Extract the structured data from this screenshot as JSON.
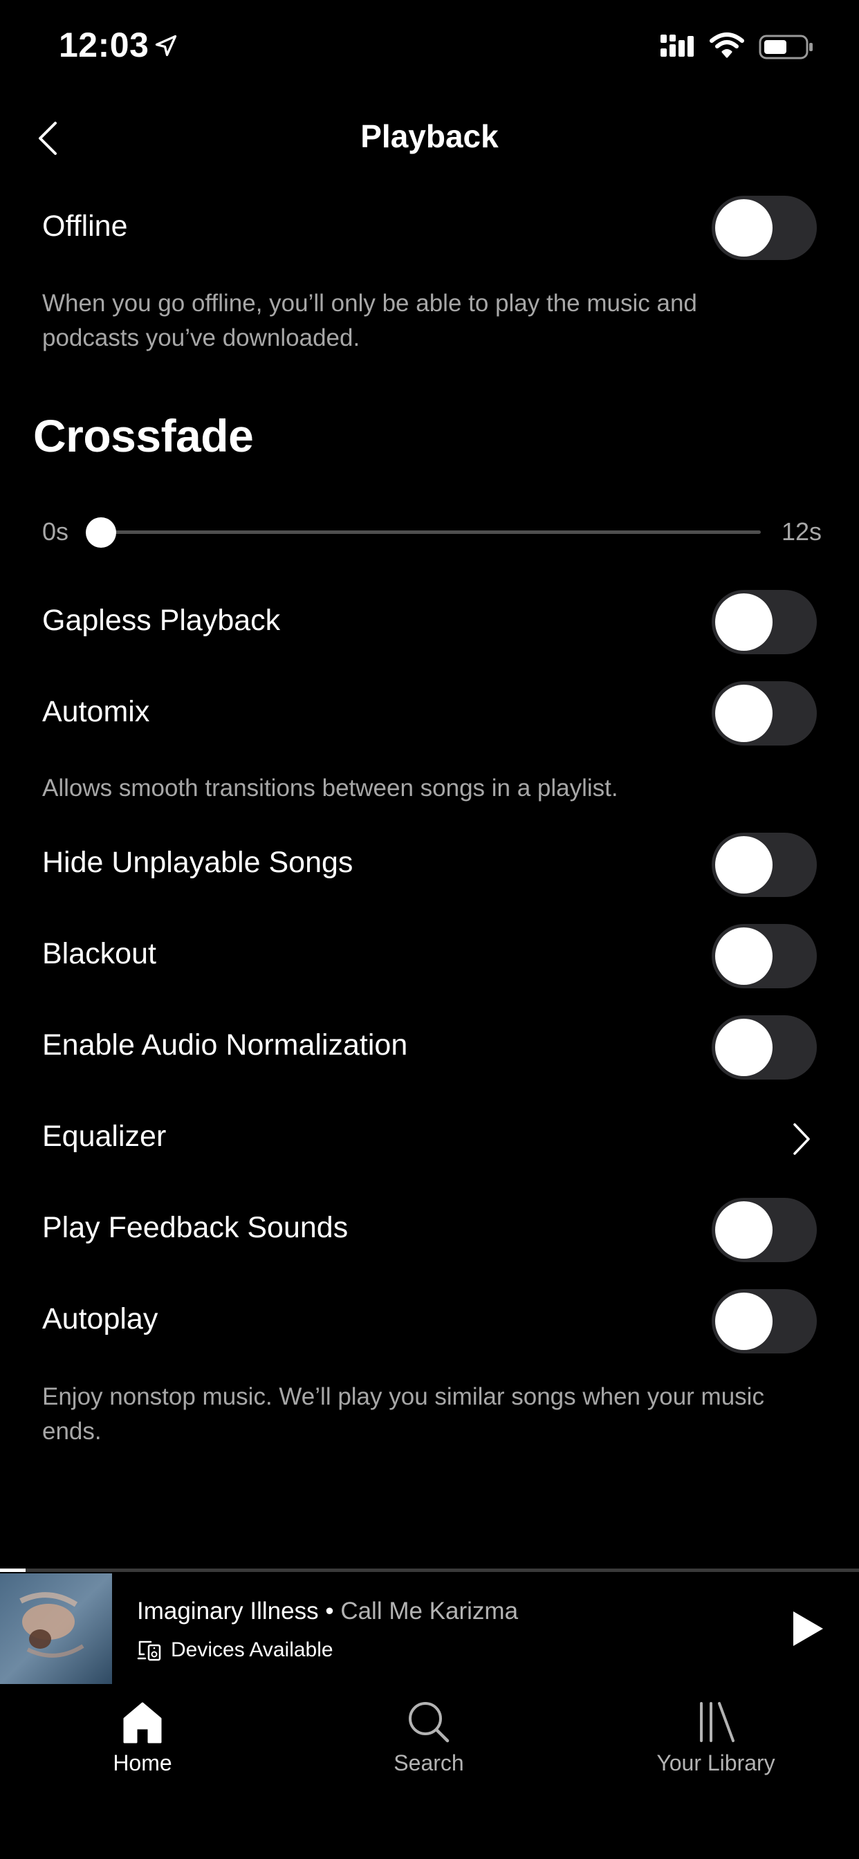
{
  "status_bar": {
    "time": "12:03"
  },
  "header": {
    "title": "Playback"
  },
  "offline": {
    "label": "Offline",
    "enabled": false,
    "description": "When you go offline, you’ll only be able to play the music and podcasts you’ve downloaded."
  },
  "crossfade": {
    "title": "Crossfade",
    "min_label": "0s",
    "max_label": "12s",
    "value_seconds": 0
  },
  "settings": {
    "gapless": {
      "label": "Gapless Playback",
      "enabled": false
    },
    "automix": {
      "label": "Automix",
      "enabled": false,
      "description": "Allows smooth transitions between songs in a playlist."
    },
    "hide_unplayable": {
      "label": "Hide Unplayable Songs",
      "enabled": false
    },
    "blackout": {
      "label": "Blackout",
      "enabled": false
    },
    "normalization": {
      "label": "Enable Audio Normalization",
      "enabled": false
    },
    "equalizer": {
      "label": "Equalizer"
    },
    "feedback_sounds": {
      "label": "Play Feedback Sounds",
      "enabled": false
    },
    "autoplay": {
      "label": "Autoplay",
      "enabled": false,
      "description": "Enjoy nonstop music. We’ll play you similar songs when your music ends."
    }
  },
  "now_playing": {
    "track": "Imaginary Illness",
    "separator": " • ",
    "artist": "Call Me Karizma",
    "device_label": "Devices Available",
    "progress": 0.03
  },
  "tab_bar": {
    "tabs": [
      {
        "label": "Home",
        "icon": "home-icon",
        "active": true
      },
      {
        "label": "Search",
        "icon": "search-icon",
        "active": false
      },
      {
        "label": "Your Library",
        "icon": "library-icon",
        "active": false
      }
    ]
  },
  "colors": {
    "background": "#000000",
    "secondary_text": "#a7a7a7",
    "toggle_off": "#2b2b2e",
    "knob": "#ffffff"
  }
}
